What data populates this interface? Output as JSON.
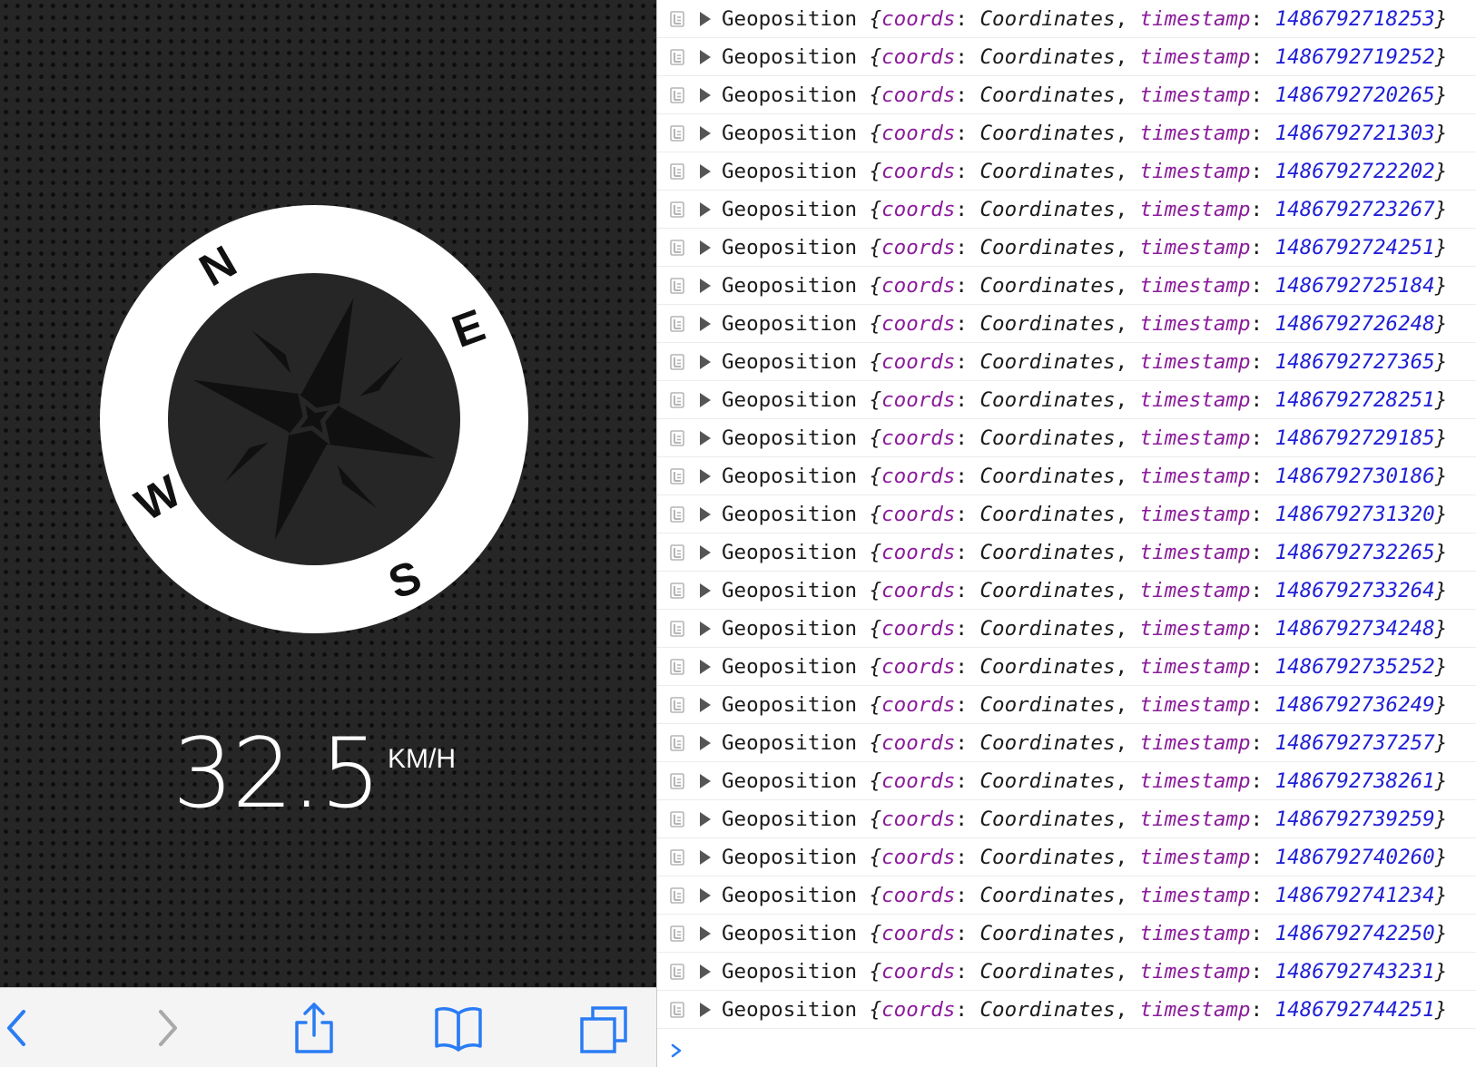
{
  "phone": {
    "compass": {
      "north": "N",
      "east": "E",
      "south": "S",
      "west": "W"
    },
    "speed": {
      "value": "32.5",
      "unit": "KM/H"
    },
    "toolbar": {
      "back_icon": "chevron-left-icon",
      "forward_icon": "chevron-right-icon",
      "share_icon": "share-icon",
      "bookmarks_icon": "book-icon",
      "tabs_icon": "tabs-icon",
      "accent": "#2a7cf4"
    }
  },
  "console": {
    "colors": {
      "key": "#8a1c9a",
      "number": "#1f1fd6"
    },
    "entries": [
      {
        "type": "Geoposition",
        "coords_key": "coords",
        "coords_val": "Coordinates",
        "ts_key": "timestamp",
        "timestamp": "1486792718253"
      },
      {
        "type": "Geoposition",
        "coords_key": "coords",
        "coords_val": "Coordinates",
        "ts_key": "timestamp",
        "timestamp": "1486792719252"
      },
      {
        "type": "Geoposition",
        "coords_key": "coords",
        "coords_val": "Coordinates",
        "ts_key": "timestamp",
        "timestamp": "1486792720265"
      },
      {
        "type": "Geoposition",
        "coords_key": "coords",
        "coords_val": "Coordinates",
        "ts_key": "timestamp",
        "timestamp": "1486792721303"
      },
      {
        "type": "Geoposition",
        "coords_key": "coords",
        "coords_val": "Coordinates",
        "ts_key": "timestamp",
        "timestamp": "1486792722202"
      },
      {
        "type": "Geoposition",
        "coords_key": "coords",
        "coords_val": "Coordinates",
        "ts_key": "timestamp",
        "timestamp": "1486792723267"
      },
      {
        "type": "Geoposition",
        "coords_key": "coords",
        "coords_val": "Coordinates",
        "ts_key": "timestamp",
        "timestamp": "1486792724251"
      },
      {
        "type": "Geoposition",
        "coords_key": "coords",
        "coords_val": "Coordinates",
        "ts_key": "timestamp",
        "timestamp": "1486792725184"
      },
      {
        "type": "Geoposition",
        "coords_key": "coords",
        "coords_val": "Coordinates",
        "ts_key": "timestamp",
        "timestamp": "1486792726248"
      },
      {
        "type": "Geoposition",
        "coords_key": "coords",
        "coords_val": "Coordinates",
        "ts_key": "timestamp",
        "timestamp": "1486792727365"
      },
      {
        "type": "Geoposition",
        "coords_key": "coords",
        "coords_val": "Coordinates",
        "ts_key": "timestamp",
        "timestamp": "1486792728251"
      },
      {
        "type": "Geoposition",
        "coords_key": "coords",
        "coords_val": "Coordinates",
        "ts_key": "timestamp",
        "timestamp": "1486792729185"
      },
      {
        "type": "Geoposition",
        "coords_key": "coords",
        "coords_val": "Coordinates",
        "ts_key": "timestamp",
        "timestamp": "1486792730186"
      },
      {
        "type": "Geoposition",
        "coords_key": "coords",
        "coords_val": "Coordinates",
        "ts_key": "timestamp",
        "timestamp": "1486792731320"
      },
      {
        "type": "Geoposition",
        "coords_key": "coords",
        "coords_val": "Coordinates",
        "ts_key": "timestamp",
        "timestamp": "1486792732265"
      },
      {
        "type": "Geoposition",
        "coords_key": "coords",
        "coords_val": "Coordinates",
        "ts_key": "timestamp",
        "timestamp": "1486792733264"
      },
      {
        "type": "Geoposition",
        "coords_key": "coords",
        "coords_val": "Coordinates",
        "ts_key": "timestamp",
        "timestamp": "1486792734248"
      },
      {
        "type": "Geoposition",
        "coords_key": "coords",
        "coords_val": "Coordinates",
        "ts_key": "timestamp",
        "timestamp": "1486792735252"
      },
      {
        "type": "Geoposition",
        "coords_key": "coords",
        "coords_val": "Coordinates",
        "ts_key": "timestamp",
        "timestamp": "1486792736249"
      },
      {
        "type": "Geoposition",
        "coords_key": "coords",
        "coords_val": "Coordinates",
        "ts_key": "timestamp",
        "timestamp": "1486792737257"
      },
      {
        "type": "Geoposition",
        "coords_key": "coords",
        "coords_val": "Coordinates",
        "ts_key": "timestamp",
        "timestamp": "1486792738261"
      },
      {
        "type": "Geoposition",
        "coords_key": "coords",
        "coords_val": "Coordinates",
        "ts_key": "timestamp",
        "timestamp": "1486792739259"
      },
      {
        "type": "Geoposition",
        "coords_key": "coords",
        "coords_val": "Coordinates",
        "ts_key": "timestamp",
        "timestamp": "1486792740260"
      },
      {
        "type": "Geoposition",
        "coords_key": "coords",
        "coords_val": "Coordinates",
        "ts_key": "timestamp",
        "timestamp": "1486792741234"
      },
      {
        "type": "Geoposition",
        "coords_key": "coords",
        "coords_val": "Coordinates",
        "ts_key": "timestamp",
        "timestamp": "1486792742250"
      },
      {
        "type": "Geoposition",
        "coords_key": "coords",
        "coords_val": "Coordinates",
        "ts_key": "timestamp",
        "timestamp": "1486792743231"
      },
      {
        "type": "Geoposition",
        "coords_key": "coords",
        "coords_val": "Coordinates",
        "ts_key": "timestamp",
        "timestamp": "1486792744251"
      }
    ],
    "prompt_icon": "chevron-right-icon"
  }
}
